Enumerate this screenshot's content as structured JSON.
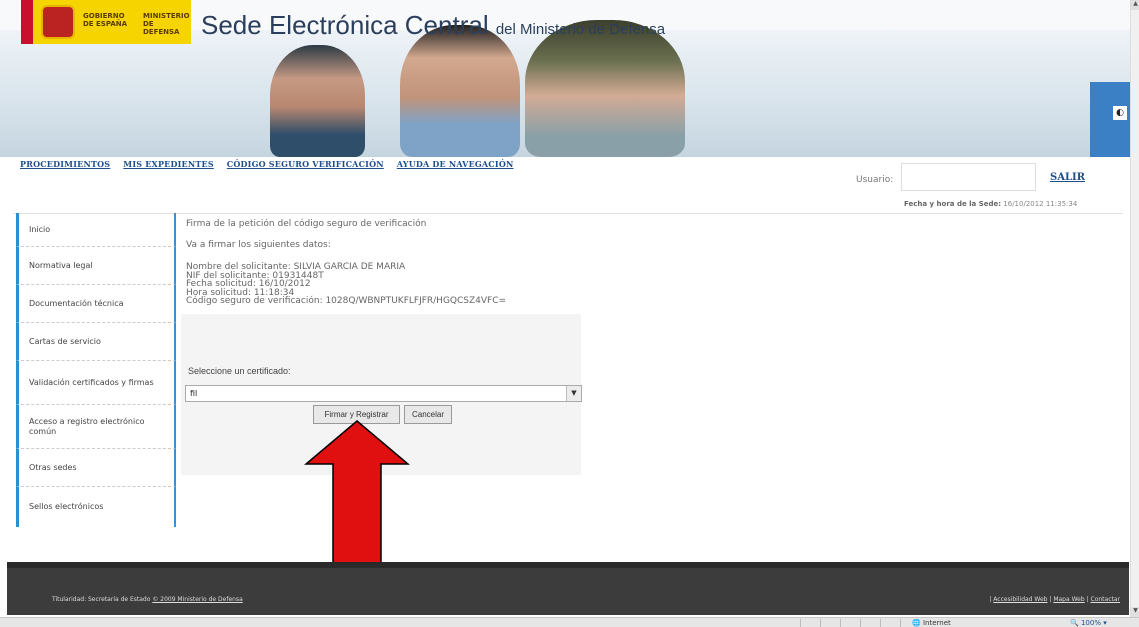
{
  "header": {
    "logo_gobierno": "GOBIERNO DE ESPAÑA",
    "logo_ministerio": "MINISTERIO DE DEFENSA",
    "title_main": "Sede Electrónica Central",
    "title_sub": "del Ministerio de Defensa",
    "contrast_icon": "◐"
  },
  "nav": {
    "items": [
      {
        "label": "PROCEDIMIENTOS"
      },
      {
        "label": "MIS EXPEDIENTES"
      },
      {
        "label": "CÓDIGO SEGURO VERIFICACIÓN"
      },
      {
        "label": "AYUDA DE NAVEGACIÓN"
      }
    ],
    "user_label": "Usuario:",
    "user_value": "",
    "logout": "SALIR",
    "datetime_label": "Fecha y hora de la Sede:",
    "datetime_value": "16/10/2012 11:35:34"
  },
  "sidebar": {
    "items": [
      {
        "label": "Inicio"
      },
      {
        "label": "Normativa legal"
      },
      {
        "label": "Documentación técnica"
      },
      {
        "label": "Cartas de servicio"
      },
      {
        "label": "Validación certificados y firmas"
      },
      {
        "label": "Acceso a registro electrónico común"
      },
      {
        "label": "Otras sedes"
      },
      {
        "label": "Sellos electrónicos"
      }
    ]
  },
  "main": {
    "heading": "Firma de la petición del código seguro de verificación",
    "intro": "Va a firmar los siguientes datos:",
    "details": [
      "Nombre del solicitante: SILVIA  GARCIA  DE MARIA",
      "NIF del solicitante: 01931448T",
      "Fecha solicitud: 16/10/2012",
      "Hora solicitud: 11:18:34",
      "Código seguro de verificación: 1028Q/WBNPTUKFLFJFR/HGQCSZ4VFC="
    ],
    "cert_label": "Seleccione un certificado:",
    "cert_value": "fil",
    "sign_button": "Firmar y Registrar",
    "cancel_button": "Cancelar"
  },
  "footer": {
    "owner_text": "Titularidad: Secretaría de Estado",
    "copyright_link": "© 2009 Ministerio de Defensa",
    "links": [
      "Accesibilidad Web",
      "Mapa Web",
      "Contactar"
    ]
  },
  "statusbar": {
    "zone": "Internet",
    "zoom": "100%"
  },
  "colors": {
    "accent": "#2e8fd0",
    "link": "#1e4e8c",
    "annotation_arrow": "#e01010"
  }
}
